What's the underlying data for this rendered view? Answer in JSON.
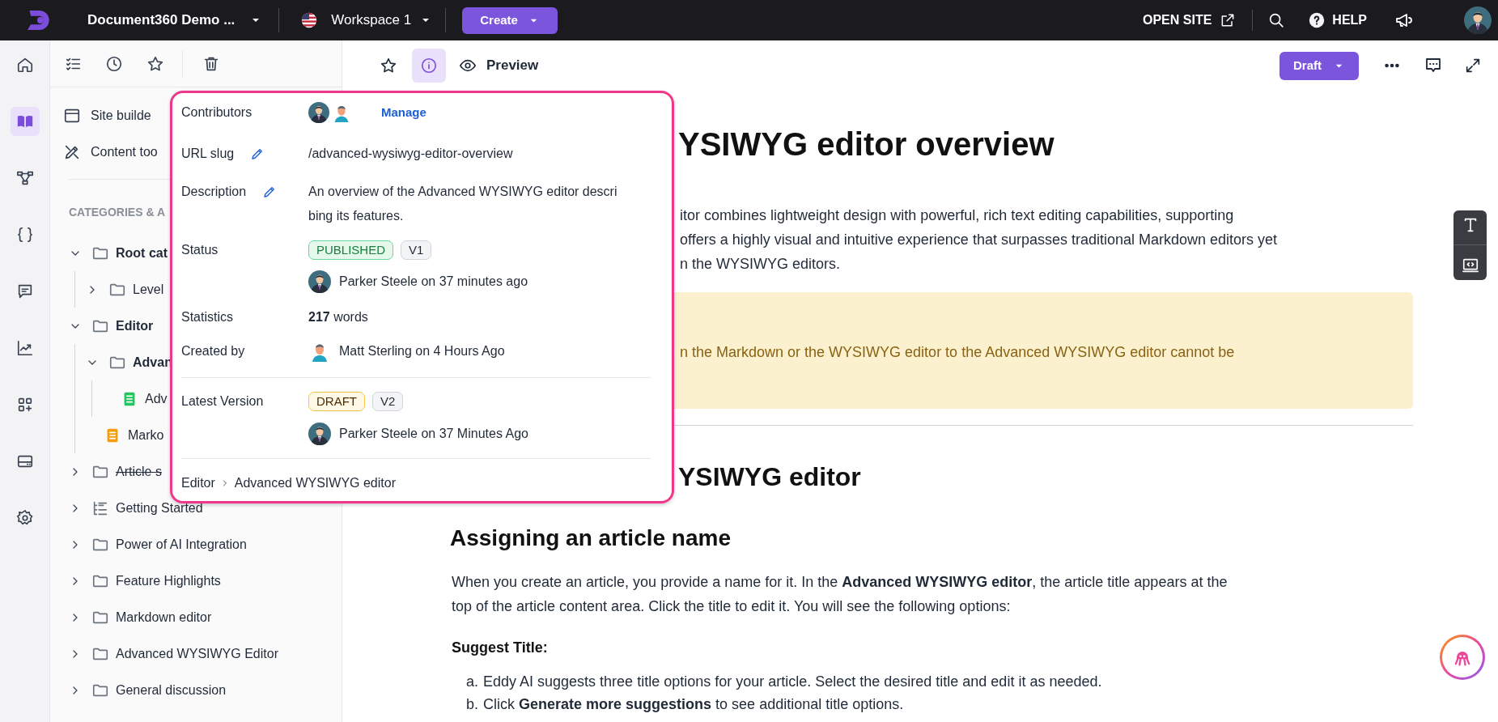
{
  "top_bar": {
    "project": "Document360 Demo ...",
    "workspace": "Workspace 1",
    "create_button": "Create",
    "open_site": "OPEN SITE",
    "help": "HELP"
  },
  "rail": [
    {
      "kind": "home",
      "selected": false
    },
    {
      "kind": "docs",
      "selected": true
    },
    {
      "kind": "hierarchy",
      "selected": false
    },
    {
      "kind": "api",
      "selected": false
    },
    {
      "kind": "feedback",
      "selected": false
    },
    {
      "kind": "analytics",
      "selected": false
    },
    {
      "kind": "apps",
      "selected": false
    },
    {
      "kind": "drive",
      "selected": false
    },
    {
      "kind": "settings",
      "selected": false
    }
  ],
  "sidebar": {
    "links": [
      {
        "kind": "site",
        "label": "Site builde"
      },
      {
        "kind": "tools",
        "label": "Content too"
      }
    ],
    "section_heading": "CATEGORIES & A",
    "tree": [
      {
        "kind": "folder",
        "label": "Root cat",
        "expanded": true,
        "strikethrough": false,
        "children": [
          {
            "kind": "folder",
            "label": "Level",
            "expanded": false,
            "strikethrough": false
          }
        ]
      },
      {
        "kind": "folder",
        "label": "Editor",
        "expanded": true,
        "strikethrough": false,
        "children": [
          {
            "kind": "folder",
            "label": "Advan",
            "expanded": true,
            "strikethrough": false,
            "children": [
              {
                "kind": "article",
                "label": "Adv",
                "color": "#22c55e",
                "strikethrough": false
              }
            ]
          },
          {
            "kind": "article",
            "label": "Marko",
            "color": "#f59e0b",
            "strikethrough": false
          }
        ]
      },
      {
        "kind": "folder",
        "label": "Article s",
        "expanded": false,
        "strikethrough": true
      },
      {
        "kind": "outline",
        "label": "Getting Started",
        "expanded": false,
        "strikethrough": false
      },
      {
        "kind": "folder",
        "label": "Power of AI Integration",
        "expanded": false,
        "strikethrough": false
      },
      {
        "kind": "folder",
        "label": "Feature Highlights",
        "expanded": false,
        "strikethrough": false
      },
      {
        "kind": "folder",
        "label": "Markdown editor",
        "expanded": false,
        "strikethrough": false
      },
      {
        "kind": "folder",
        "label": "Advanced WYSIWYG Editor",
        "expanded": false,
        "strikethrough": false
      },
      {
        "kind": "folder",
        "label": "General discussion",
        "expanded": false,
        "strikethrough": false
      }
    ]
  },
  "toolbar": {
    "buttons": [
      {
        "kind": "star",
        "selected": false
      },
      {
        "kind": "info",
        "selected": true
      }
    ],
    "preview": "Preview",
    "status_button": "Draft"
  },
  "info_panel": {
    "contributors_label": "Contributors",
    "manage_link": "Manage",
    "url_slug_label": "URL slug",
    "url_slug": "/advanced-wysiwyg-editor-overview",
    "description_label": "Description",
    "description": "An overview of the Advanced WYSIWYG editor describing its features.",
    "status_label": "Status",
    "status_badges": [
      {
        "kind": "published",
        "label": "PUBLISHED"
      },
      {
        "kind": "version",
        "label": "V1"
      }
    ],
    "status_author": "Parker Steele on 37 minutes ago",
    "statistics_label": "Statistics",
    "statistics": "**217** words",
    "created_by_label": "Created by",
    "created_by": "Matt Sterling on 4 Hours Ago",
    "latest_version_label": "Latest Version",
    "latest_badges": [
      {
        "kind": "draft",
        "label": "DRAFT"
      },
      {
        "kind": "version",
        "label": "V2"
      }
    ],
    "latest_author": "Parker Steele on 37 Minutes Ago",
    "breadcrumb": [
      "Editor",
      "Advanced WYSIWYG editor"
    ]
  },
  "article": {
    "title": "YSIWYG editor overview",
    "intro_lines": [
      "itor combines lightweight design with powerful, rich text editing capabilities, supporting",
      "offers a highly visual and intuitive experience that surpasses traditional Markdown editors yet",
      "n the WYSIWYG editors."
    ],
    "callout_line": "n the Markdown or the WYSIWYG editor to the Advanced WYSIWYG editor cannot be",
    "heading": "YSIWYG editor",
    "subheading": "Assigning an article name",
    "paragraph": "When you create an article, you provide a name for it. In the **Advanced WYSIWYG editor**, the article title appears at the top of the article content area. Click the title to edit it. You will see the following options:",
    "label": "Suggest Title:",
    "list": [
      {
        "marker": "a.",
        "text": "Eddy AI suggests three title options for your article. Select the desired title and edit it as needed."
      },
      {
        "marker": "b.",
        "text": "Click **Generate more suggestions** to see additional title options."
      }
    ]
  }
}
